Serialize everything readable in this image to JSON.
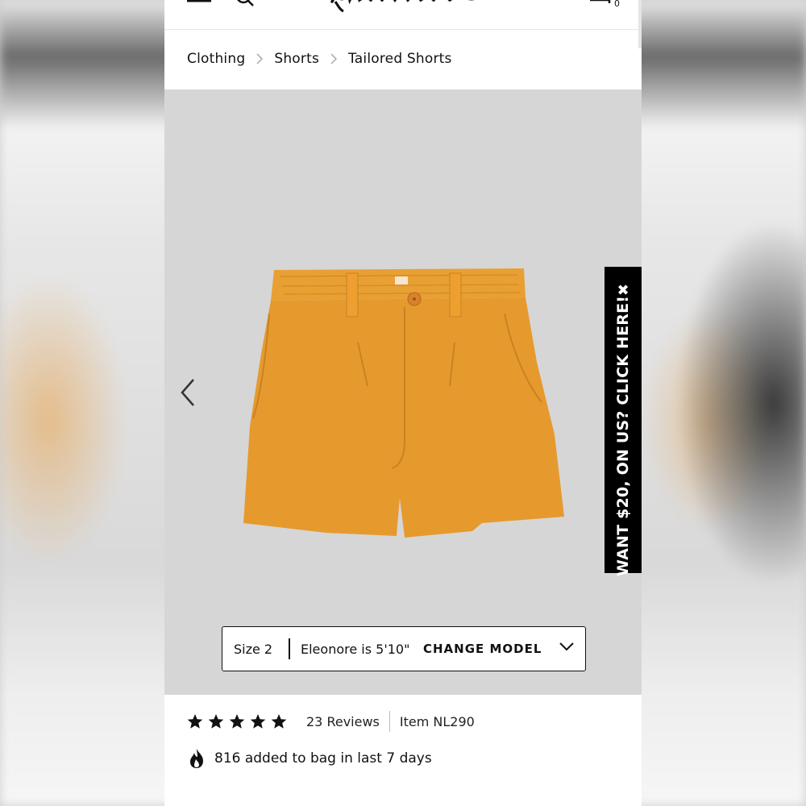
{
  "brand": {
    "logo_text": "Madewell"
  },
  "breadcrumb": [
    {
      "label": "Clothing"
    },
    {
      "label": "Shorts"
    },
    {
      "label": "Tailored Shorts"
    }
  ],
  "promo": {
    "text": "WANT $20, ON US? CLICK HERE!",
    "close_glyph": "✖"
  },
  "model_selector": {
    "size": "Size 2",
    "model": "Eleonore is 5'10\"",
    "action": "CHANGE MODEL"
  },
  "rating": {
    "stars": 5,
    "max": 5,
    "reviews": "23 Reviews"
  },
  "item": {
    "number": "Item NL290"
  },
  "social_proof": {
    "text": "816 added to bag in last 7 days"
  },
  "colors": {
    "product": "#e69a2e",
    "gallery_bg": "#d6d6d6",
    "text": "#111111"
  },
  "icons": [
    "menu-icon",
    "search-icon",
    "account-icon",
    "bag-icon",
    "chevron-right-icon",
    "chevron-left-icon",
    "close-icon",
    "chevron-down-icon",
    "star-icon",
    "fire-icon"
  ]
}
